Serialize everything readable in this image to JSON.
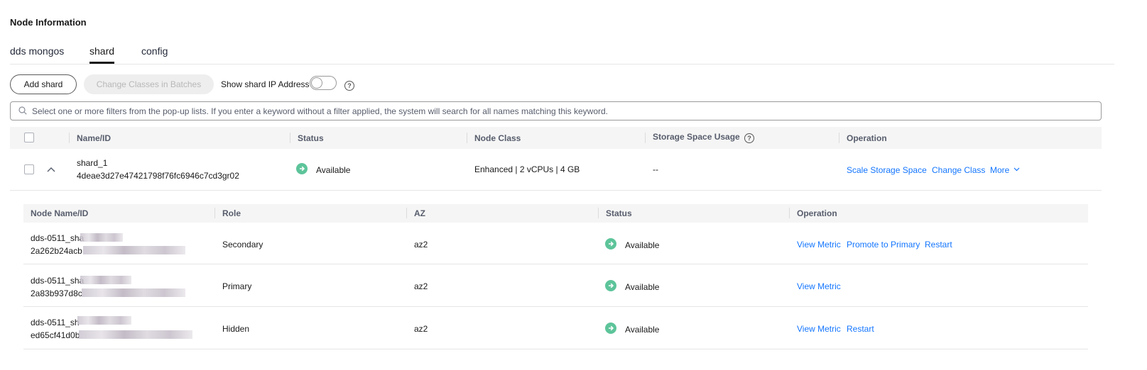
{
  "page": {
    "title": "Node Information"
  },
  "tabs": [
    {
      "label": "dds mongos",
      "active": false
    },
    {
      "label": "shard",
      "active": true
    },
    {
      "label": "config",
      "active": false
    }
  ],
  "toolbar": {
    "add_label": "Add shard",
    "change_label": "Change Classes in Batches",
    "toggle_label": "Show shard IP Address",
    "toggle_on": false
  },
  "search": {
    "placeholder": "Select one or more filters from the pop-up lists. If you enter a keyword without a filter applied, the system will search for all names matching this keyword."
  },
  "table": {
    "headers": {
      "name": "Name/ID",
      "status": "Status",
      "node_class": "Node Class",
      "storage": "Storage Space Usage",
      "operation": "Operation"
    },
    "rows": [
      {
        "name": "shard_1",
        "id": "4deae3d27e47421798f76fc6946c7cd3gr02",
        "status": "Available",
        "node_class": "Enhanced | 2 vCPUs | 4 GB",
        "storage": "--",
        "ops": [
          "Scale Storage Space",
          "Change Class",
          "More"
        ]
      }
    ]
  },
  "sub_table": {
    "headers": {
      "name": "Node Name/ID",
      "role": "Role",
      "az": "AZ",
      "status": "Status",
      "operation": "Operation"
    },
    "rows": [
      {
        "name": "dds-0511_sha",
        "id": "2a262b24acb",
        "role": "Secondary",
        "az": "az2",
        "status": "Available",
        "ops": [
          "View Metric",
          "Promote to Primary",
          "Restart"
        ]
      },
      {
        "name": "dds-0511_sha",
        "id": "2a83b937d8c",
        "role": "Primary",
        "az": "az2",
        "status": "Available",
        "ops": [
          "View Metric"
        ]
      },
      {
        "name": "dds-0511_sh",
        "id": "ed65cf41d0b",
        "role": "Hidden",
        "az": "az2",
        "status": "Available",
        "ops": [
          "View Metric",
          "Restart"
        ]
      }
    ]
  },
  "colors": {
    "link": "#1476ff",
    "status_ok": "#5dc49a"
  }
}
